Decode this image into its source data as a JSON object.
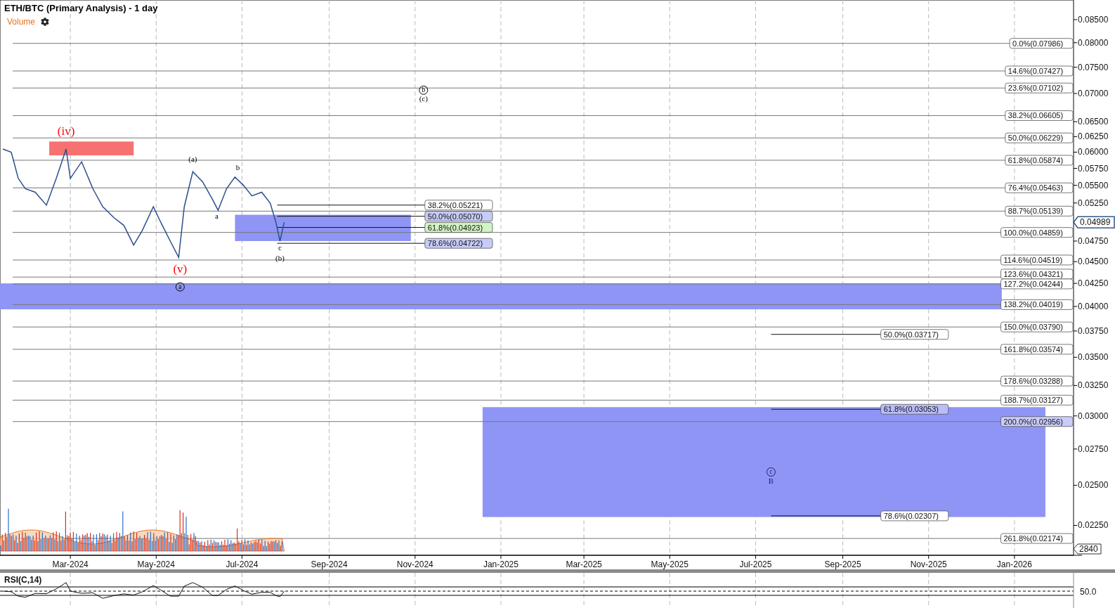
{
  "title": "ETH/BTC (Primary Analysis) - 1 day",
  "volume_label": "Volume",
  "price_tag": "0.04989",
  "volume_tag": "2840",
  "price_axis": [
    "0.08500",
    "0.08000",
    "0.07500",
    "0.07000",
    "0.06500",
    "0.06250",
    "0.06000",
    "0.05750",
    "0.05500",
    "0.05250",
    "0.04750",
    "0.04500",
    "0.04250",
    "0.04000",
    "0.03750",
    "0.03500",
    "0.03250",
    "0.03000",
    "0.02750",
    "0.02500",
    "0.02250"
  ],
  "date_axis": [
    "Mar-2024",
    "May-2024",
    "Jul-2024",
    "Sep-2024",
    "Nov-2024",
    "Jan-2025",
    "Mar-2025",
    "May-2025",
    "Jul-2025",
    "Sep-2025",
    "Nov-2025",
    "Jan-2026"
  ],
  "fib_labels": [
    "0.0%(0.07986)",
    "14.6%(0.07427)",
    "23.6%(0.07102)",
    "38.2%(0.06605)",
    "50.0%(0.06229)",
    "61.8%(0.05874)",
    "76.4%(0.05463)",
    "88.7%(0.05139)",
    "100.0%(0.04859)",
    "114.6%(0.04519)",
    "123.6%(0.04321)",
    "127.2%(0.04244)",
    "138.2%(0.04019)",
    "150.0%(0.03790)",
    "161.8%(0.03574)",
    "178.6%(0.03288)",
    "188.7%(0.03127)",
    "200.0%(0.02956)",
    "261.8%(0.02174)",
    "38.2%(0.05221)",
    "50.0%(0.05070)",
    "61.8%(0.04923)",
    "78.6%(0.04722)",
    "50.0%(0.03717)",
    "61.8%(0.03053)",
    "78.6%(0.02307)"
  ],
  "wave_labels": [
    "(iv)",
    "(v)",
    "a",
    "(a)",
    "a",
    "b",
    "c",
    "(b)",
    "b",
    "(c)",
    "c",
    "B"
  ],
  "rsi": {
    "label": "RSI(C,14)",
    "tick": "50.0"
  }
}
